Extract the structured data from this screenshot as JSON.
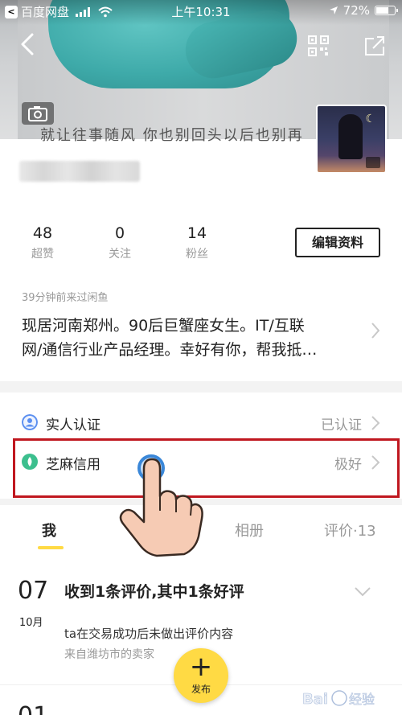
{
  "status_bar": {
    "back_app": "百度网盘",
    "time": "上午10:31",
    "battery": "72%",
    "battery_level": 0.72
  },
  "cover": {
    "text": "就让往事随风 你也别回头以后也别再"
  },
  "stats": [
    {
      "value": "48",
      "label": "超赞"
    },
    {
      "value": "0",
      "label": "关注"
    },
    {
      "value": "14",
      "label": "粉丝"
    }
  ],
  "edit_profile_label": "编辑资料",
  "last_seen": "39分钟前来过闲鱼",
  "bio": {
    "line1": "现居河南郑州。90后巨蟹座女生。IT/互联",
    "line2": "网/通信行业产品经理。幸好有你，帮我抵…"
  },
  "certifications": [
    {
      "name": "实人认证",
      "value": "已认证",
      "icon": "person-verify-icon",
      "color": "#5b8ff0"
    },
    {
      "name": "芝麻信用",
      "value": "极好",
      "icon": "sesame-credit-icon",
      "color": "#3cbf8e"
    }
  ],
  "tabs": [
    {
      "label": "我",
      "active": true
    },
    {
      "label": "相册",
      "active": false
    },
    {
      "label": "评价·13",
      "active": false
    }
  ],
  "feed": {
    "day": "07",
    "month": "10月",
    "title": "收到1条评价,其中1条好评",
    "description": "ta在交易成功后未做出评价内容",
    "source": "来自潍坊市的卖家",
    "next_day": "01"
  },
  "fab": {
    "label": "发布"
  },
  "colors": {
    "accent_yellow": "#ffda44",
    "highlight_red": "#c0171f"
  },
  "watermark": "Baidu经验"
}
